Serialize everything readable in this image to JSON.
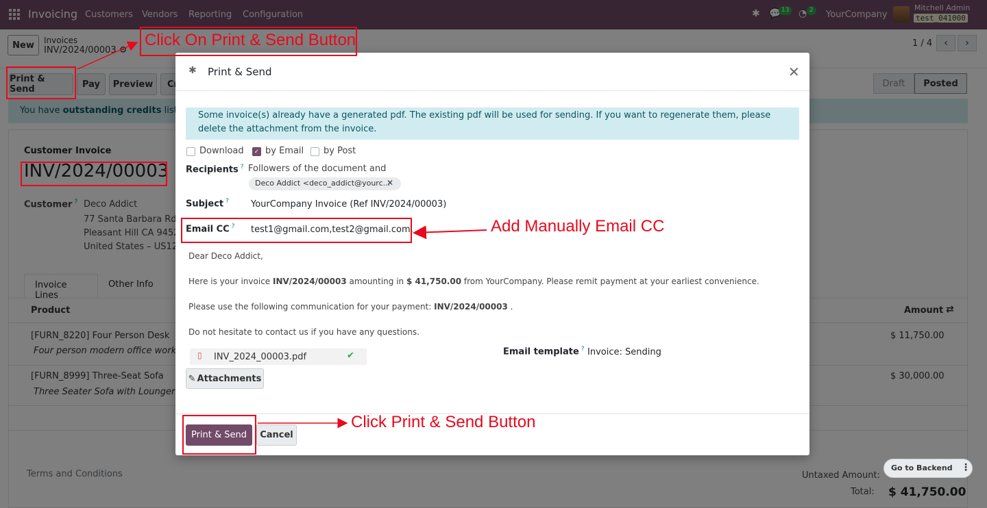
{
  "nav": {
    "app_name": "Invoicing",
    "menus": [
      "Customers",
      "Vendors",
      "Reporting",
      "Configuration"
    ],
    "chat_badge": "13",
    "activity_badge": "2",
    "company": "YourCompany",
    "user": "Mitchell Admin",
    "db": "test_041000"
  },
  "control": {
    "new_label": "New",
    "breadcrumb_parent": "Invoices",
    "breadcrumb_current": "INV/2024/00003",
    "pager": "1 / 4",
    "buttons": [
      "Print & Send",
      "Pay",
      "Preview",
      "Cr"
    ],
    "status_draft": "Draft",
    "status_posted": "Posted"
  },
  "alert": {
    "text_pre": "You have ",
    "text_bold": "outstanding credits",
    "text_post": " listed be"
  },
  "form": {
    "type_label": "Customer Invoice",
    "number": "INV/2024/00003",
    "customer_label": "Customer",
    "customer_name": "Deco Addict",
    "address": [
      "77 Santa Barbara Rd",
      "Pleasant Hill CA 94523",
      "United States – US123"
    ],
    "tabs": [
      "Invoice Lines",
      "Other Info"
    ],
    "col_product": "Product",
    "col_amount": "Amount",
    "lines": [
      {
        "product": "[FURN_8220] Four Person Desk",
        "desc": "Four person modern office workstat",
        "amount": "$ 11,750.00"
      },
      {
        "product": "[FURN_8999] Three-Seat Sofa",
        "desc": "Three Seater Sofa with Lounger in S",
        "amount": "$ 30,000.00"
      }
    ],
    "terms": "Terms and Conditions",
    "untaxed_label": "Untaxed Amount:",
    "total_label": "Total:",
    "total_value": "$ 41,750.00"
  },
  "modal": {
    "title": "Print & Send",
    "info": "Some invoice(s) already have a generated pdf. The existing pdf will be used for sending. If you want to regenerate them, please delete the attachment from the invoice.",
    "options": [
      {
        "label": "Download",
        "checked": false
      },
      {
        "label": "by Email",
        "checked": true
      },
      {
        "label": "by Post",
        "checked": false
      }
    ],
    "recipients_label": "Recipients",
    "recipients_text": "Followers of the document and",
    "recipient_tag": "Deco Addict <deco_addict@yourc...",
    "subject_label": "Subject",
    "subject_value": "YourCompany Invoice (Ref INV/2024/00003)",
    "cc_label": "Email CC",
    "cc_value": "test1@gmail.com,test2@gmail.com,",
    "greeting": "Dear Deco Addict,",
    "p1_pre": "Here is your invoice ",
    "p1_inv": "INV/2024/00003",
    "p1_mid": " amounting in ",
    "p1_amt": "$ 41,750.00",
    "p1_post": " from YourCompany. Please remit payment at your earliest convenience.",
    "p2_pre": "Please use the following communication for your payment: ",
    "p2_inv": "INV/2024/00003",
    "p2_post": " .",
    "p3": "Do not hesitate to contact us if you have any questions.",
    "attachment_name": "INV_2024_00003.pdf",
    "attachments_btn": "Attachments",
    "template_label": "Email template",
    "template_value": "Invoice: Sending",
    "primary_btn": "Print & Send",
    "cancel_btn": "Cancel"
  },
  "annotations": {
    "a1": "Click On Print & Send Button",
    "a2": "Add Manually Email CC",
    "a3": "Click Print & Send Button",
    "color": "#e8091c"
  },
  "floating": {
    "go_backend": "Go to Backend"
  }
}
